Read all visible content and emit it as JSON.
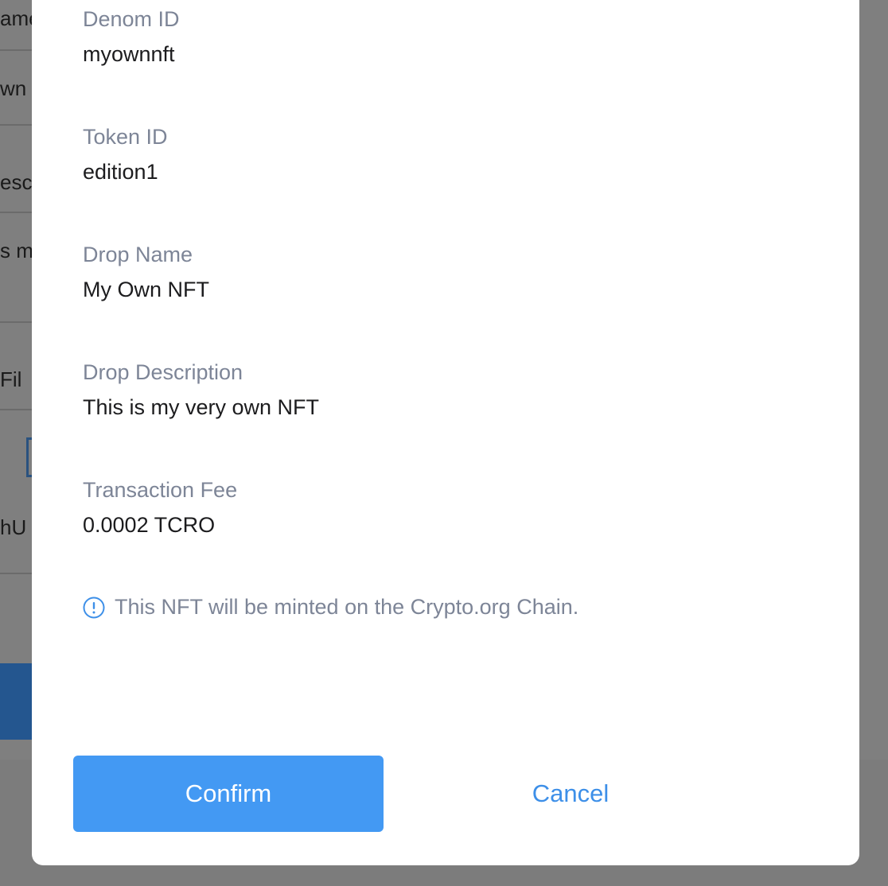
{
  "background": {
    "fragments": [
      "ame",
      "wn",
      "esc",
      "s m",
      "Fil",
      "hU"
    ]
  },
  "modal": {
    "fields": [
      {
        "label": "Denom ID",
        "value": "myownnft"
      },
      {
        "label": "Token ID",
        "value": "edition1"
      },
      {
        "label": "Drop Name",
        "value": "My Own NFT"
      },
      {
        "label": "Drop Description",
        "value": "This is my very own NFT"
      },
      {
        "label": "Transaction Fee",
        "value": "0.0002 TCRO"
      }
    ],
    "info": {
      "icon": "info-circle-icon",
      "text": "This NFT will be minted on the Crypto.org Chain."
    },
    "buttons": {
      "confirm_label": "Confirm",
      "cancel_label": "Cancel"
    }
  },
  "colors": {
    "primary": "#4399f3",
    "label_gray": "#7d8597",
    "overlay": "#7f7f7f"
  }
}
